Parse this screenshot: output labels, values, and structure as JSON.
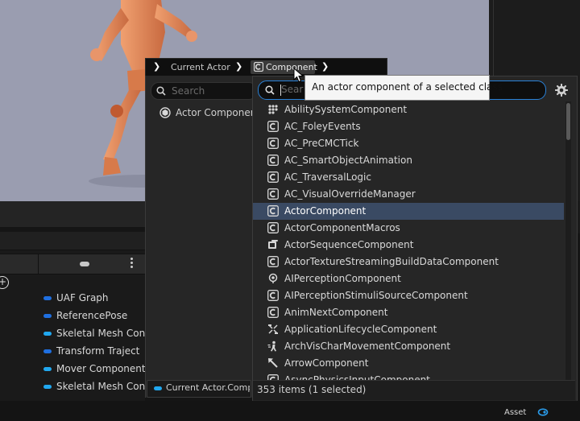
{
  "breadcrumb": {
    "items": [
      "Current Actor",
      "Component"
    ]
  },
  "left_panel": {
    "search_placeholder": "Search",
    "tree_item": "Actor Componen",
    "rows": [
      {
        "label": "UAF Graph",
        "color": "#1f6fe0"
      },
      {
        "label": "ReferencePose",
        "color": "#1f6fe0"
      },
      {
        "label": "Skeletal Mesh Con",
        "color": "#21a8f0"
      },
      {
        "label": "Transform Traject",
        "color": "#1f6fe0"
      },
      {
        "label": "Mover Component",
        "color": "#21a8f0"
      },
      {
        "label": "Skeletal Mesh Con",
        "color": "#21a8f0"
      }
    ],
    "bottom_chip": "Current Actor.Compo"
  },
  "popup": {
    "search_value": "Sear",
    "tooltip": "An actor component of a selected class",
    "items": [
      {
        "label": "AbilitySystemComponent",
        "icon": "dots-grid-icon"
      },
      {
        "label": "AC_FoleyEvents",
        "icon": "c-class-icon"
      },
      {
        "label": "AC_PreCMCTick",
        "icon": "c-class-icon"
      },
      {
        "label": "AC_SmartObjectAnimation",
        "icon": "c-class-icon"
      },
      {
        "label": "AC_TraversalLogic",
        "icon": "c-class-icon"
      },
      {
        "label": "AC_VisualOverrideManager",
        "icon": "c-class-icon"
      },
      {
        "label": "ActorComponent",
        "icon": "c-class-icon",
        "selected": true
      },
      {
        "label": "ActorComponentMacros",
        "icon": "c-class-icon"
      },
      {
        "label": "ActorSequenceComponent",
        "icon": "sequence-icon"
      },
      {
        "label": "ActorTextureStreamingBuildDataComponent",
        "icon": "c-class-icon"
      },
      {
        "label": "AIPerceptionComponent",
        "icon": "perception-icon"
      },
      {
        "label": "AIPerceptionStimuliSourceComponent",
        "icon": "c-class-icon"
      },
      {
        "label": "AnimNextComponent",
        "icon": "c-class-icon"
      },
      {
        "label": "ApplicationLifecycleComponent",
        "icon": "lifecycle-icon"
      },
      {
        "label": "ArchVisCharMovementComponent",
        "icon": "movement-icon"
      },
      {
        "label": "ArrowComponent",
        "icon": "arrow-icon"
      },
      {
        "label": "AsyncPhysicsInputComponent",
        "icon": "c-class-icon"
      }
    ],
    "footer": "353 items (1 selected)"
  },
  "bottom_bar": {
    "asset_label": "Asset"
  },
  "colors": {
    "accent": "#2a82d8",
    "selection": "#3a4a63"
  }
}
